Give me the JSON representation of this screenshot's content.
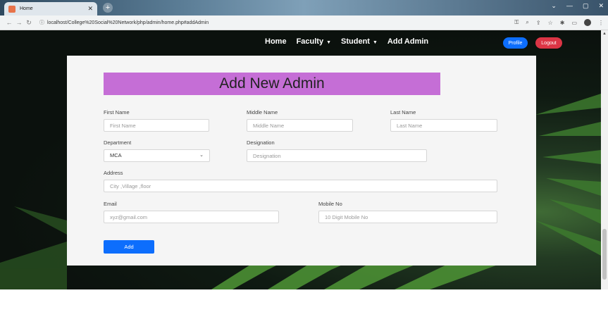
{
  "browser": {
    "tab_title": "Home",
    "url": "localhost/College%20Social%20Network/php/admin/home.php#addAdmin"
  },
  "navbar": {
    "links": [
      "Home",
      "Faculty",
      "Student",
      "Add Admin"
    ],
    "profile_label": "Profile",
    "logout_label": "Logout"
  },
  "form": {
    "title": "Add New Admin",
    "first_name": {
      "label": "First Name",
      "placeholder": "First Name"
    },
    "middle_name": {
      "label": "Middle Name",
      "placeholder": "Middle Name"
    },
    "last_name": {
      "label": "Last Name",
      "placeholder": "Last Name"
    },
    "department": {
      "label": "Department",
      "value": "MCA"
    },
    "designation": {
      "label": "Designation",
      "placeholder": "Designation"
    },
    "address": {
      "label": "Address",
      "placeholder": "City ,Village ,floor"
    },
    "email": {
      "label": "Email",
      "placeholder": "xyz@gmail.com"
    },
    "mobile": {
      "label": "Mobile No",
      "placeholder": "10 Digit Mobile No"
    },
    "submit_label": "Add"
  }
}
